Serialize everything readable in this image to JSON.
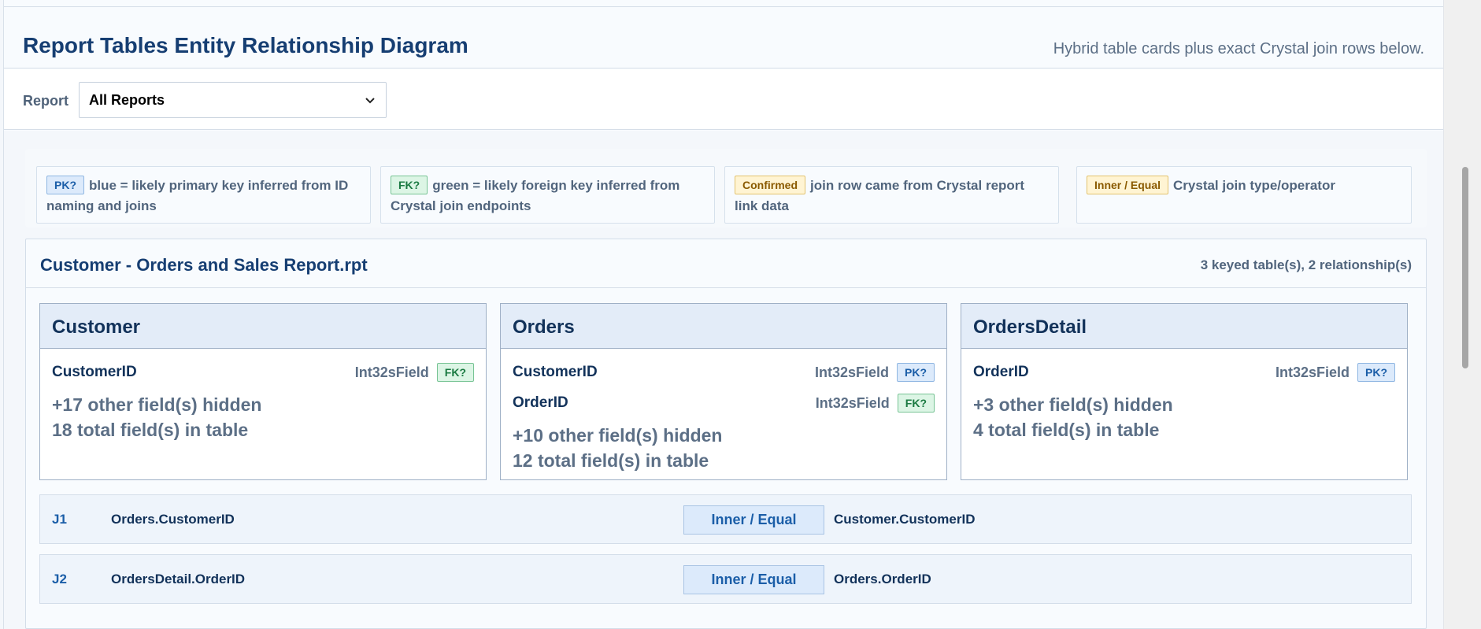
{
  "header": {
    "title": "Report Tables Entity Relationship Diagram",
    "subtitle": "Hybrid table cards plus exact Crystal join rows below."
  },
  "filter": {
    "label": "Report",
    "selected": "All Reports",
    "icon": "chevron-down-icon"
  },
  "legend": [
    {
      "badge": "PK?",
      "kind": "pk",
      "text": "blue = likely primary key inferred from ID naming and joins"
    },
    {
      "badge": "FK?",
      "kind": "fk",
      "text": "green = likely foreign key inferred from Crystal join endpoints"
    },
    {
      "badge": "Confirmed",
      "kind": "confirmed",
      "text": "join row came from Crystal report link data"
    },
    {
      "badge": "Inner / Equal",
      "kind": "inner",
      "text": "Crystal join type/operator"
    }
  ],
  "report": {
    "title": "Customer - Orders and Sales Report.rpt",
    "stats": "3 keyed table(s), 2 relationship(s)",
    "tables": [
      {
        "name": "Customer",
        "fields": [
          {
            "name": "CustomerID",
            "type": "Int32sField",
            "badge": "FK?",
            "kind": "fk"
          }
        ],
        "hidden": "+17 other field(s) hidden",
        "total": "18 total field(s) in table"
      },
      {
        "name": "Orders",
        "fields": [
          {
            "name": "CustomerID",
            "type": "Int32sField",
            "badge": "PK?",
            "kind": "pk"
          },
          {
            "name": "OrderID",
            "type": "Int32sField",
            "badge": "FK?",
            "kind": "fk"
          }
        ],
        "hidden": "+10 other field(s) hidden",
        "total": "12 total field(s) in table"
      },
      {
        "name": "OrdersDetail",
        "fields": [
          {
            "name": "OrderID",
            "type": "Int32sField",
            "badge": "PK?",
            "kind": "pk"
          }
        ],
        "hidden": "+3 other field(s) hidden",
        "total": "4 total field(s) in table"
      }
    ],
    "joins": [
      {
        "id": "J1",
        "left": "Orders.CustomerID",
        "type": "Inner / Equal",
        "right": "Customer.CustomerID"
      },
      {
        "id": "J2",
        "left": "OrdersDetail.OrderID",
        "type": "Inner / Equal",
        "right": "Orders.OrderID"
      }
    ]
  }
}
